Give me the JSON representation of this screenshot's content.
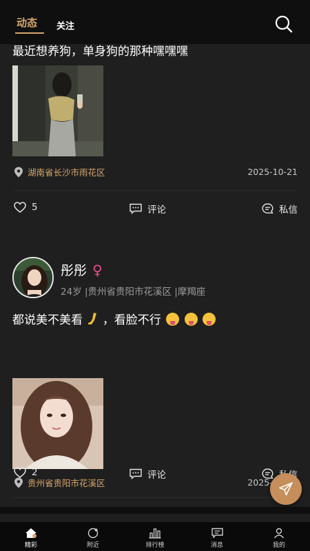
{
  "header": {
    "tabs": [
      {
        "label": "动态",
        "active": true
      },
      {
        "label": "关注",
        "active": false
      }
    ]
  },
  "posts": [
    {
      "text": "最近想养狗，单身狗的那种嘿嘿嘿",
      "location": "湖南省长沙市雨花区",
      "date": "2025-10-21",
      "likes": "5",
      "comment_label": "评论",
      "message_label": "私信"
    },
    {
      "username": "彤彤",
      "gender_symbol": "♀",
      "user_info": "24岁 |贵州省贵阳市花溪区 |摩羯座",
      "text": "都说美不美看",
      "text_after": "，看脸不行",
      "location": "贵州省贵阳市花溪区",
      "date": "2025-10-21",
      "likes": "2",
      "comment_label": "评论",
      "message_label": "私信"
    }
  ],
  "tabbar": [
    {
      "label": "精彩",
      "icon": "home-icon",
      "active": true
    },
    {
      "label": "附近",
      "icon": "nearby-icon",
      "active": false
    },
    {
      "label": "排行榜",
      "icon": "ranking-icon",
      "active": false
    },
    {
      "label": "消息",
      "icon": "message-icon",
      "active": false
    },
    {
      "label": "我的",
      "icon": "profile-icon",
      "active": false
    }
  ],
  "colors": {
    "accent": "#d7a66a",
    "card_bg": "#1f1f1f",
    "page_bg": "#0f0f0f",
    "gender_female": "#e84d8a",
    "fab": "#c68e5a"
  }
}
